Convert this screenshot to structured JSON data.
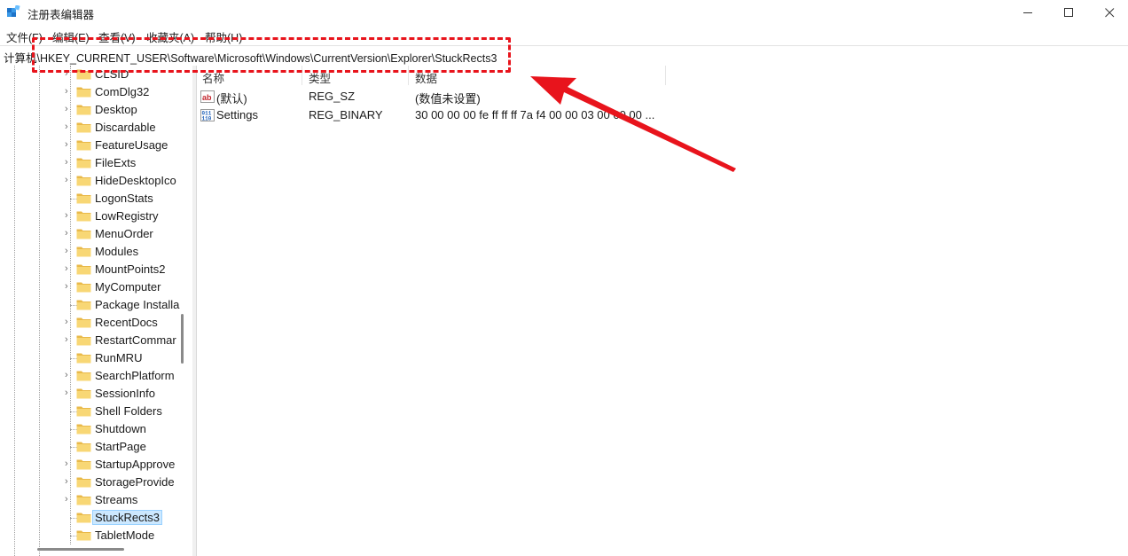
{
  "window": {
    "title": "注册表编辑器"
  },
  "menu": [
    "文件(F)",
    "编辑(E)",
    "查看(V)",
    "收藏夹(A)",
    "帮助(H)"
  ],
  "address": "计算机\\HKEY_CURRENT_USER\\Software\\Microsoft\\Windows\\CurrentVersion\\Explorer\\StuckRects3",
  "tree": {
    "items": [
      {
        "label": "CLSID",
        "expandable": true
      },
      {
        "label": "ComDlg32",
        "expandable": true
      },
      {
        "label": "Desktop",
        "expandable": true
      },
      {
        "label": "Discardable",
        "expandable": true
      },
      {
        "label": "FeatureUsage",
        "expandable": true
      },
      {
        "label": "FileExts",
        "expandable": true
      },
      {
        "label": "HideDesktopIco",
        "expandable": true
      },
      {
        "label": "LogonStats",
        "expandable": false
      },
      {
        "label": "LowRegistry",
        "expandable": true
      },
      {
        "label": "MenuOrder",
        "expandable": true
      },
      {
        "label": "Modules",
        "expandable": true
      },
      {
        "label": "MountPoints2",
        "expandable": true
      },
      {
        "label": "MyComputer",
        "expandable": true
      },
      {
        "label": "Package Installa",
        "expandable": false
      },
      {
        "label": "RecentDocs",
        "expandable": true
      },
      {
        "label": "RestartCommar",
        "expandable": true
      },
      {
        "label": "RunMRU",
        "expandable": false
      },
      {
        "label": "SearchPlatform",
        "expandable": true
      },
      {
        "label": "SessionInfo",
        "expandable": true
      },
      {
        "label": "Shell Folders",
        "expandable": false
      },
      {
        "label": "Shutdown",
        "expandable": false
      },
      {
        "label": "StartPage",
        "expandable": false
      },
      {
        "label": "StartupApprove",
        "expandable": true
      },
      {
        "label": "StorageProvide",
        "expandable": true
      },
      {
        "label": "Streams",
        "expandable": true
      },
      {
        "label": "StuckRects3",
        "expandable": false,
        "selected": true
      },
      {
        "label": "TabletMode",
        "expandable": false
      }
    ]
  },
  "list": {
    "columns": [
      "名称",
      "类型",
      "数据"
    ],
    "rows": [
      {
        "icon": "string-value-icon",
        "name": "(默认)",
        "type": "REG_SZ",
        "data": "(数值未设置)"
      },
      {
        "icon": "binary-value-icon",
        "name": "Settings",
        "type": "REG_BINARY",
        "data": "30 00 00 00 fe ff ff ff 7a f4 00 00 03 00 00 00 ..."
      }
    ]
  },
  "colors": {
    "annotation": "#e8141c",
    "selection": "#cce8ff",
    "folder": "#f8d775"
  }
}
